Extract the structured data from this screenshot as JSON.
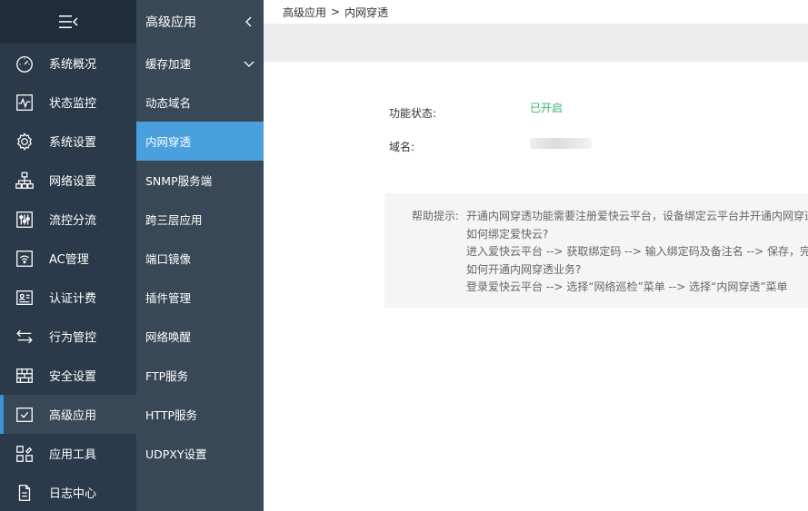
{
  "nav": {
    "items": [
      {
        "label": "系统概况",
        "icon": "dashboard-icon"
      },
      {
        "label": "状态监控",
        "icon": "pulse-icon"
      },
      {
        "label": "系统设置",
        "icon": "gear-icon"
      },
      {
        "label": "网络设置",
        "icon": "network-icon"
      },
      {
        "label": "流控分流",
        "icon": "sliders-icon"
      },
      {
        "label": "AC管理",
        "icon": "wifi-icon"
      },
      {
        "label": "认证计费",
        "icon": "id-card-icon"
      },
      {
        "label": "行为管控",
        "icon": "arrows-icon"
      },
      {
        "label": "安全设置",
        "icon": "firewall-icon"
      },
      {
        "label": "高级应用",
        "icon": "check-box-icon"
      },
      {
        "label": "应用工具",
        "icon": "tools-icon"
      },
      {
        "label": "日志中心",
        "icon": "document-icon"
      }
    ]
  },
  "submenu": {
    "title": "高级应用",
    "items": [
      "缓存加速",
      "动态域名",
      "内网穿透",
      "SNMP服务端",
      "跨三层应用",
      "端口镜像",
      "插件管理",
      "网络唤醒",
      "FTP服务",
      "HTTP服务",
      "UDPXY设置"
    ]
  },
  "breadcrumb": {
    "parent": "高级应用",
    "sep": ">",
    "current": "内网穿透"
  },
  "form": {
    "status_label": "功能状态:",
    "status_value": "已开启",
    "domain_label": "域名:"
  },
  "help": {
    "label": "帮助提示:",
    "lines": [
      "开通内网穿透功能需要注册爱快云平台，设备绑定云平台并开通内网穿透",
      "如何绑定爱快云?",
      "进入爱快云平台 --> 获取绑定码 --> 输入绑定码及备注名 --> 保存，完",
      "如何开通内网穿透业务?",
      "登录爱快云平台 --> 选择“网络巡检”菜单 --> 选择“内网穿透”菜单"
    ]
  },
  "colors": {
    "accent": "#4a9fdd",
    "status_on": "#3fb471",
    "sidebar": "#2b3a4a"
  }
}
